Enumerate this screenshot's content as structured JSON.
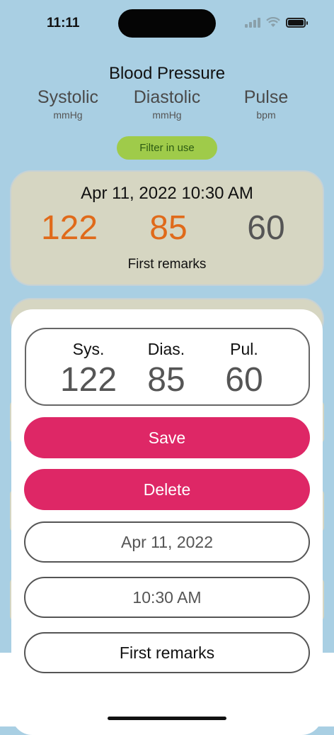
{
  "status_bar": {
    "time": "11:11"
  },
  "header": {
    "title": "Blood Pressure",
    "columns": [
      {
        "name": "Systolic",
        "unit": "mmHg"
      },
      {
        "name": "Diastolic",
        "unit": "mmHg"
      },
      {
        "name": "Pulse",
        "unit": "bpm"
      }
    ],
    "filter_label": "Filter in use"
  },
  "entry": {
    "datetime": "Apr 11, 2022 10:30 AM",
    "systolic": "122",
    "diastolic": "85",
    "pulse": "60",
    "remarks": "First remarks"
  },
  "editor": {
    "labels": {
      "sys": "Sys.",
      "dias": "Dias.",
      "pul": "Pul."
    },
    "values": {
      "sys": "122",
      "dias": "85",
      "pul": "60"
    },
    "save_label": "Save",
    "delete_label": "Delete",
    "date_value": "Apr 11, 2022",
    "time_value": "10:30 AM",
    "remarks_value": "First remarks"
  },
  "colors": {
    "background": "#a9cfe3",
    "card": "#d6d6c2",
    "filter_pill": "#9fcb4a",
    "accent_red": "#de2766",
    "high_value": "#e06a1a"
  }
}
